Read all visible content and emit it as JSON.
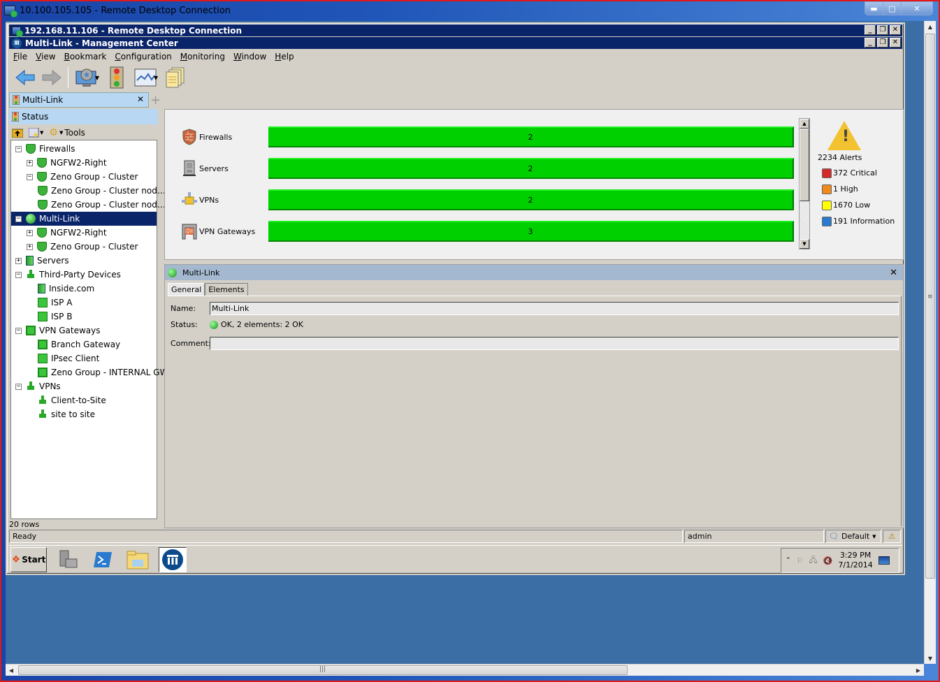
{
  "outer_window": {
    "title": "10.100.105.105 - Remote Desktop Connection",
    "controls": [
      "minimize",
      "maximize",
      "close"
    ]
  },
  "inner_rdp": {
    "title": "192.168.11.106 - Remote Desktop Connection"
  },
  "app": {
    "title": "Multi-Link - Management Center",
    "icon_glyph": "Ⅲ"
  },
  "menu": {
    "items": [
      {
        "label": "File",
        "u": "F",
        "rest": "ile"
      },
      {
        "label": "View",
        "u": "V",
        "rest": "iew"
      },
      {
        "label": "Bookmark",
        "u": "B",
        "rest": "ookmark"
      },
      {
        "label": "Configuration",
        "u": "C",
        "rest": "onfiguration"
      },
      {
        "label": "Monitoring",
        "u": "M",
        "rest": "onitoring"
      },
      {
        "label": "Window",
        "u": "W",
        "rest": "indow"
      },
      {
        "label": "Help",
        "u": "H",
        "rest": "elp"
      }
    ]
  },
  "toolbar": {
    "buttons": [
      "back-arrow-icon",
      "forward-arrow-icon",
      "configuration-icon",
      "status-traffic-light-icon",
      "monitoring-chart-icon",
      "documents-icon"
    ]
  },
  "left_panel": {
    "tab_label": "Multi-Link",
    "section_title": "Status",
    "tools_label": "Tools",
    "rows_count": "20 rows",
    "tree": [
      {
        "label": "Firewalls",
        "level": 0,
        "expander": "−",
        "icon": "shield"
      },
      {
        "label": "NGFW2-Right",
        "level": 1,
        "expander": "+",
        "icon": "shield"
      },
      {
        "label": "Zeno Group - Cluster",
        "level": 1,
        "expander": "−",
        "icon": "shield"
      },
      {
        "label": "Zeno Group - Cluster nod…",
        "level": 2,
        "expander": "",
        "icon": "shield"
      },
      {
        "label": "Zeno Group - Cluster nod…",
        "level": 2,
        "expander": "",
        "icon": "shield"
      },
      {
        "label": "Multi-Link",
        "level": 0,
        "expander": "−",
        "icon": "globe",
        "selected": true
      },
      {
        "label": "NGFW2-Right",
        "level": 1,
        "expander": "+",
        "icon": "shield"
      },
      {
        "label": "Zeno Group - Cluster",
        "level": 1,
        "expander": "+",
        "icon": "shield"
      },
      {
        "label": "Servers",
        "level": 0,
        "expander": "+",
        "icon": "srv"
      },
      {
        "label": "Third-Party Devices",
        "level": 0,
        "expander": "−",
        "icon": "vpn"
      },
      {
        "label": "Inside.com",
        "level": 2,
        "expander": "",
        "icon": "srv"
      },
      {
        "label": "ISP A",
        "level": 2,
        "expander": "",
        "icon": "router"
      },
      {
        "label": "ISP B",
        "level": 2,
        "expander": "",
        "icon": "router"
      },
      {
        "label": "VPN Gateways",
        "level": 0,
        "expander": "−",
        "icon": "gw"
      },
      {
        "label": "Branch Gateway",
        "level": 2,
        "expander": "",
        "icon": "gw"
      },
      {
        "label": "IPsec Client",
        "level": 2,
        "expander": "",
        "icon": "router"
      },
      {
        "label": "Zeno Group -  INTERNAL GW",
        "level": 2,
        "expander": "",
        "icon": "gw"
      },
      {
        "label": "VPNs",
        "level": 0,
        "expander": "−",
        "icon": "vpn"
      },
      {
        "label": "Client-to-Site",
        "level": 2,
        "expander": "",
        "icon": "vpn"
      },
      {
        "label": "site to site",
        "level": 2,
        "expander": "",
        "icon": "vpn"
      }
    ]
  },
  "dashboard": {
    "categories": [
      {
        "label": "Firewalls",
        "count": "2",
        "status_color": "#00d000",
        "icon": "firewall-icon"
      },
      {
        "label": "Servers",
        "count": "2",
        "status_color": "#00d000",
        "icon": "server-icon"
      },
      {
        "label": "VPNs",
        "count": "2",
        "status_color": "#00d000",
        "icon": "vpn-icon"
      },
      {
        "label": "VPN Gateways",
        "count": "3",
        "status_color": "#00d000",
        "icon": "vpn-gateway-icon"
      }
    ],
    "alerts": {
      "total_label": "2234 Alerts",
      "items": [
        {
          "label": "372 Critical",
          "color": "#d42a2a"
        },
        {
          "label": "1 High",
          "color": "#f08a1a"
        },
        {
          "label": "1670 Low",
          "color": "#ffff00"
        },
        {
          "label": "191 Information",
          "color": "#2a7ad0"
        }
      ]
    }
  },
  "detail": {
    "title": "Multi-Link",
    "tabs": [
      {
        "label": "General",
        "active": true
      },
      {
        "label": "Elements",
        "active": false
      }
    ],
    "fields": {
      "name_label": "Name:",
      "name_value": "Multi-Link",
      "status_label": "Status:",
      "status_value": "OK, 2 elements: 2 OK",
      "comment_label": "Comment:",
      "comment_value": ""
    }
  },
  "statusbar": {
    "message": "Ready",
    "user": "admin",
    "profile": "Default"
  },
  "taskbar": {
    "start_label": "Start",
    "apps": [
      "server-manager-icon",
      "powershell-icon",
      "file-explorer-icon",
      "management-center-icon"
    ],
    "clock_time": "3:29 PM",
    "clock_date": "7/1/2014"
  }
}
